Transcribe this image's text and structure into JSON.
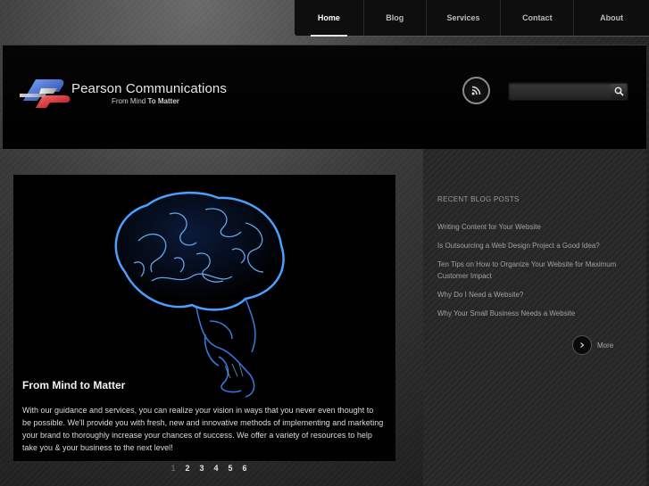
{
  "nav": {
    "items": [
      {
        "label": "Home",
        "active": true
      },
      {
        "label": "Blog"
      },
      {
        "label": "Services"
      },
      {
        "label": "Contact"
      },
      {
        "label": "About"
      }
    ]
  },
  "header": {
    "brand": "Pearson Communications",
    "tagline_pre": "From Mind",
    "tagline_bold": "To Matter",
    "rss_icon": "rss-icon",
    "search": {
      "value": "",
      "icon": "search-icon"
    }
  },
  "feature": {
    "title": "From Mind to Matter",
    "text": "With our guidance and services, you can realize your vision in ways that you never even thought to be possible. We'll provide you with fresh, new and innovative methods of implementing and marketing your brand to thoroughly increase your chances of success. We offer a variety of resources to help take you & your business to the next level!"
  },
  "pager": {
    "pages": [
      "1",
      "2",
      "3",
      "4",
      "5",
      "6"
    ],
    "current": "1"
  },
  "sidebar": {
    "heading": "RECENT BLOG POSTS",
    "posts": [
      "Writing Content for Your Website",
      "Is Outsourcing a Web Design Project a Good Idea?",
      "Ten Tips on How to Organize Your Website for Maximum Customer Impact",
      "Why Do I Need a Website?",
      "Why Your Small Business Needs a Website"
    ],
    "more_label": "More"
  },
  "colors": {
    "logo_blue": "#2d56b8",
    "logo_red": "#d6262d",
    "brain_glow": "#3d8cff"
  }
}
